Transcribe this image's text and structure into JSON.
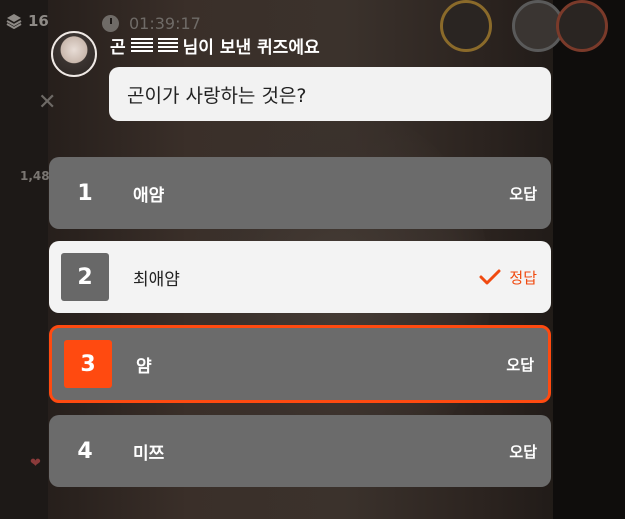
{
  "hud": {
    "viewer_count": "16",
    "elapsed_time": "01:39:17",
    "side_count": "1,48"
  },
  "quiz": {
    "sender_prefix": "곤",
    "sender_suffix": "님이 보낸 퀴즈에요",
    "question": "곤이가 사랑하는 것은?",
    "options": [
      {
        "number": "1",
        "label": "애얌",
        "result": "오답",
        "state": "wrong"
      },
      {
        "number": "2",
        "label": "최애얌",
        "result": "정답",
        "state": "correct"
      },
      {
        "number": "3",
        "label": "얌",
        "result": "오답",
        "state": "selected-wrong"
      },
      {
        "number": "4",
        "label": "미쯔",
        "result": "오답",
        "state": "wrong"
      }
    ]
  },
  "colors": {
    "accent": "#ff4a10",
    "correct_text": "#f04a10",
    "option_bg": "#6b6b6b",
    "correct_bg": "#f3f3f3"
  },
  "icons": {
    "layers": "layers-icon",
    "clock": "clock-icon",
    "close": "close-icon",
    "check": "check-icon"
  }
}
